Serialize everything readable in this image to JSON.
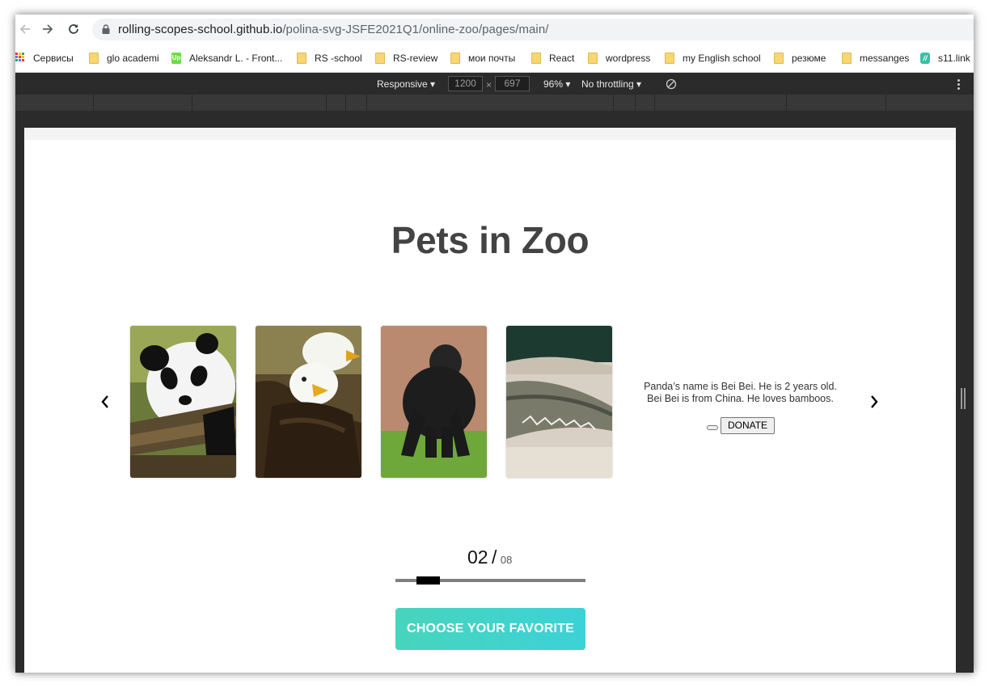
{
  "browser": {
    "url_domain": "rolling-scopes-school.github.io",
    "url_path": "/polina-svg-JSFE2021Q1/online-zoo/pages/main/",
    "bookmarks": [
      {
        "label": "Сервисы",
        "icon": "apps-grid-icon"
      },
      {
        "label": "glo academi",
        "icon": "folder-icon"
      },
      {
        "label": "Aleksandr L. - Front...",
        "icon": "upwork-icon"
      },
      {
        "label": "RS -school",
        "icon": "folder-icon"
      },
      {
        "label": "RS-review",
        "icon": "folder-icon"
      },
      {
        "label": "мои почты",
        "icon": "folder-icon"
      },
      {
        "label": "React",
        "icon": "folder-icon"
      },
      {
        "label": "wordpress",
        "icon": "folder-icon"
      },
      {
        "label": "my English school",
        "icon": "folder-icon"
      },
      {
        "label": "резюме",
        "icon": "folder-icon"
      },
      {
        "label": "messanges",
        "icon": "folder-icon"
      },
      {
        "label": "s11.link",
        "icon": "s11-icon"
      }
    ]
  },
  "devtools": {
    "device": "Responsive",
    "width": "1200",
    "times": "×",
    "height": "697",
    "zoom": "96%",
    "throttling": "No throttling"
  },
  "page": {
    "title": "Pets in Zoo",
    "carousel": {
      "cards": [
        {
          "animal": "panda"
        },
        {
          "animal": "eagle"
        },
        {
          "animal": "gorilla"
        },
        {
          "animal": "crocodile"
        }
      ],
      "info_line1": "Panda’s name is Bei Bei. He is 2 years old.",
      "info_line2": "Bei Bei is from China. He loves bamboos.",
      "donate_label": "DONATE"
    },
    "counter": {
      "current": "02",
      "separator": "/",
      "total": "08"
    },
    "progress": 0.125,
    "cta_label": "CHOOSE YOUR FAVORITE"
  },
  "colors": {
    "title": "#434343",
    "cta_gradient_start": "#48d4bd",
    "cta_gradient_end": "#3cd2d6",
    "devtools_bg": "#2b2b2b"
  }
}
